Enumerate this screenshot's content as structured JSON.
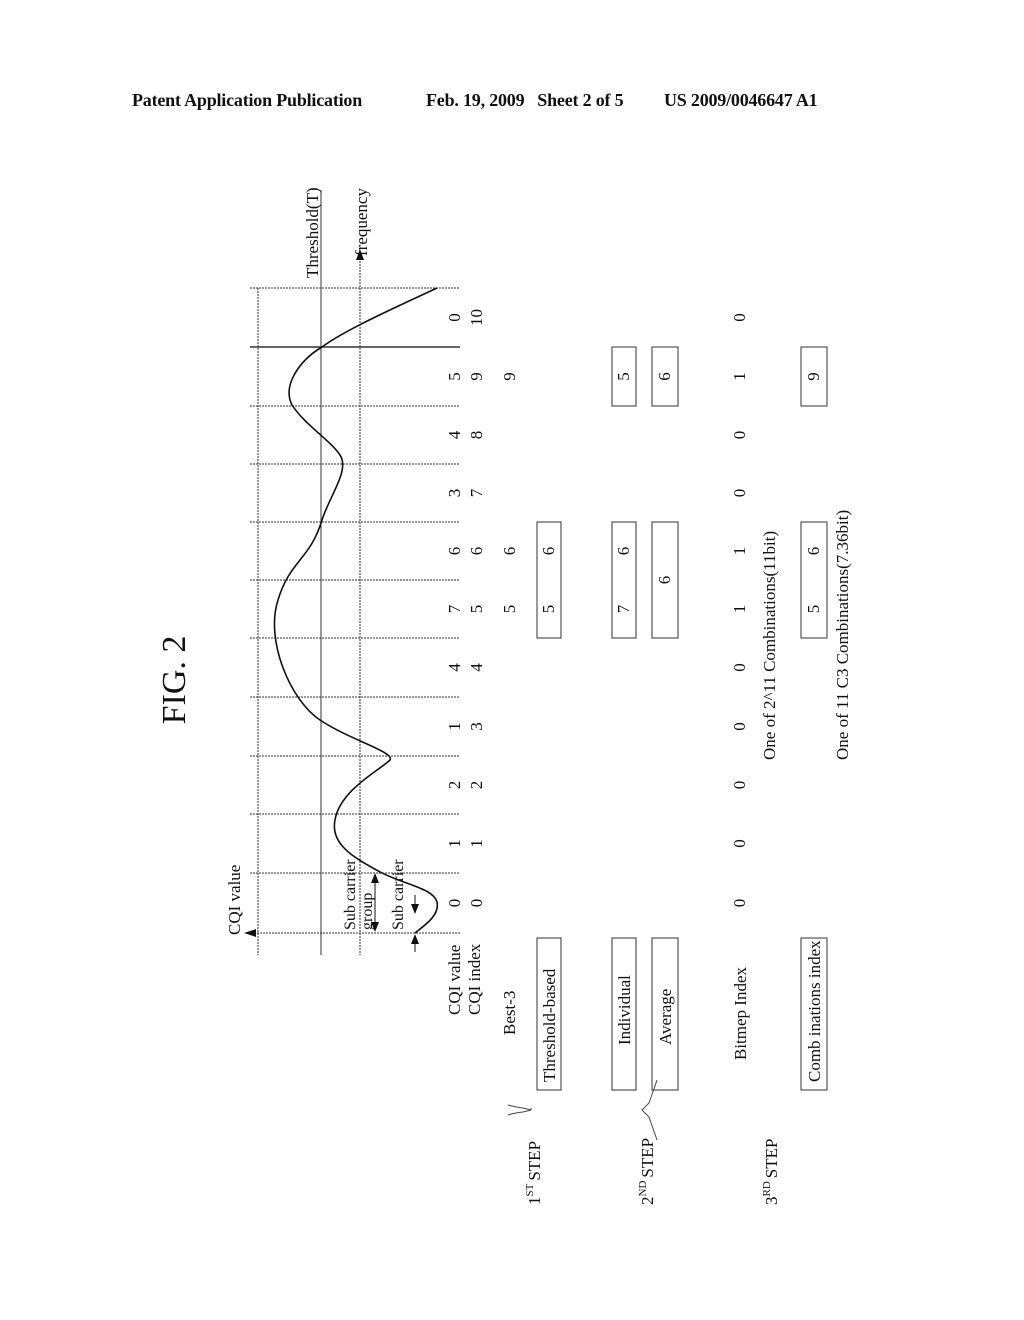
{
  "header": {
    "left": "Patent Application Publication",
    "date_sheet": "Feb. 19, 2009   Sheet 2 of 5",
    "number": "US 2009/0046647 A1"
  },
  "figure": {
    "title": "FIG. 2",
    "labels": {
      "y_axis": "CQI value",
      "x_axis": "frequency",
      "threshold": "Threshold(T)",
      "sub_carrier_group_1": "Sub carrier",
      "sub_carrier_group_2": "group",
      "sub_carrier": "Sub carrier"
    },
    "row_labels": {
      "cqi_value": "CQI value",
      "cqi_index": "CQI index",
      "best3": "Best-3",
      "threshold_based": "Threshold-based",
      "individual": "Individual",
      "average": "Average",
      "bitmap_index": "Bitmep Index",
      "combinations_index": "Comb inations index"
    },
    "steps": {
      "step1": {
        "num": "1",
        "sup": "ST",
        "word": "STEP"
      },
      "step2": {
        "num": "2",
        "sup": "ND",
        "word": "STEP"
      },
      "step3": {
        "num": "3",
        "sup": "RD",
        "word": "STEP"
      }
    },
    "notes": {
      "bitmap_combos": "One of 2^11 Combinations(11bit)",
      "c3_combos": "One of 11 C3 Combinations(7.36bit)"
    }
  },
  "chart_data": {
    "type": "line",
    "title": "FIG. 2",
    "xlabel": "frequency",
    "ylabel": "CQI value",
    "threshold_label": "Threshold(T)",
    "cqi_index": [
      "0",
      "1",
      "2",
      "3",
      "4",
      "5",
      "6",
      "7",
      "8",
      "9",
      "10"
    ],
    "cqi_value": [
      "0",
      "1",
      "2",
      "1",
      "4",
      "7",
      "6",
      "3",
      "4",
      "5",
      "0"
    ],
    "best3": [
      "",
      "",
      "",
      "",
      "",
      "5",
      "6",
      "",
      "",
      "9",
      ""
    ],
    "threshold_based": [
      "5",
      "6"
    ],
    "individual": {
      "group1": [
        "7",
        "6"
      ],
      "group2": [
        "5"
      ]
    },
    "average": {
      "group1": [
        "6"
      ],
      "group2": [
        "6"
      ]
    },
    "bitmap_index": [
      "0",
      "0",
      "0",
      "0",
      "0",
      "1",
      "1",
      "0",
      "0",
      "1",
      "0"
    ],
    "combinations_index": {
      "group1": [
        "5",
        "6"
      ],
      "group2": [
        "9"
      ]
    }
  }
}
